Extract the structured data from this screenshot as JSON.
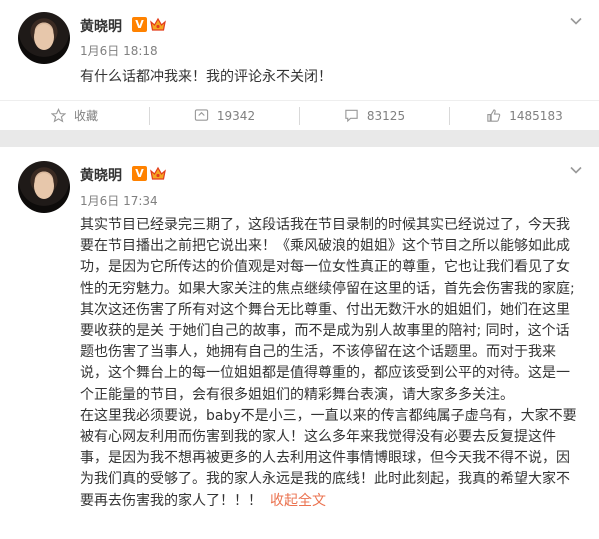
{
  "post1": {
    "author": "黄晓明",
    "verified_badge": "V",
    "meta": "1月6日  18:18",
    "text": "有什么话都冲我来！我的评论永不关闭！",
    "actions": {
      "favorite": "收藏",
      "repost": "19342",
      "comment": "83125",
      "like": "1485183"
    }
  },
  "post2": {
    "author": "黄晓明",
    "verified_badge": "V",
    "meta": "1月6日  17:34",
    "lines": [
      "其实节目已经录完三期了，这段话我在节目录制的时候其实已经说过了，今天我",
      "要在节目播出之前把它说出来！《乘风破浪的姐姐》这个节目之所以能够如此成",
      "功，是因为它所传达的价值观是对每一位女性真正的尊重，它也让我们看见了女",
      "性的无穷魅力。如果大家关注的焦点继续停留在这里的话，首先会伤害我的家庭;",
      "其次这还伤害了所有对这个舞台无比尊重、付出无数汗水的姐姐们，她们在这里",
      "要收获的是关 于她们自己的故事，而不是成为别人故事里的陪衬; 同时，这个话",
      "题也伤害了当事人，她拥有自己的生活，不该停留在这个话题里。而对于我来",
      "说，这个舞台上的每一位姐姐都是值得尊重的，都应该受到公平的对待。这是一",
      "个正能量的节目，会有很多姐姐们的精彩舞台表演，请大家多多关注。",
      "在这里我必须要说，baby不是小三，一直以来的传言都纯属子虚乌有，大家不要",
      "被有心网友利用而伤害到我的家人！这么多年来我觉得没有必要去反复提这件",
      "事，是因为我不想再被更多的人去利用这件事情博眼球，但今天我不得不说，因",
      "为我们真的受够了。我的家人永远是我的底线！此时此刻起，我真的希望大家不"
    ],
    "last_line": "要再去伤害我的家人了！！！",
    "collapse_label": "收起全文"
  },
  "colors": {
    "accent_orange": "#ff8200",
    "link_orange": "#eb7350",
    "meta_gray": "#808080",
    "background": "#e9e9e9"
  },
  "icons": {
    "verified": "verified-v-icon",
    "crown": "crown-icon",
    "menu": "chevron-down-icon",
    "favorite": "star-icon",
    "repost": "repost-icon",
    "comment": "comment-icon",
    "like": "thumbs-up-icon"
  }
}
